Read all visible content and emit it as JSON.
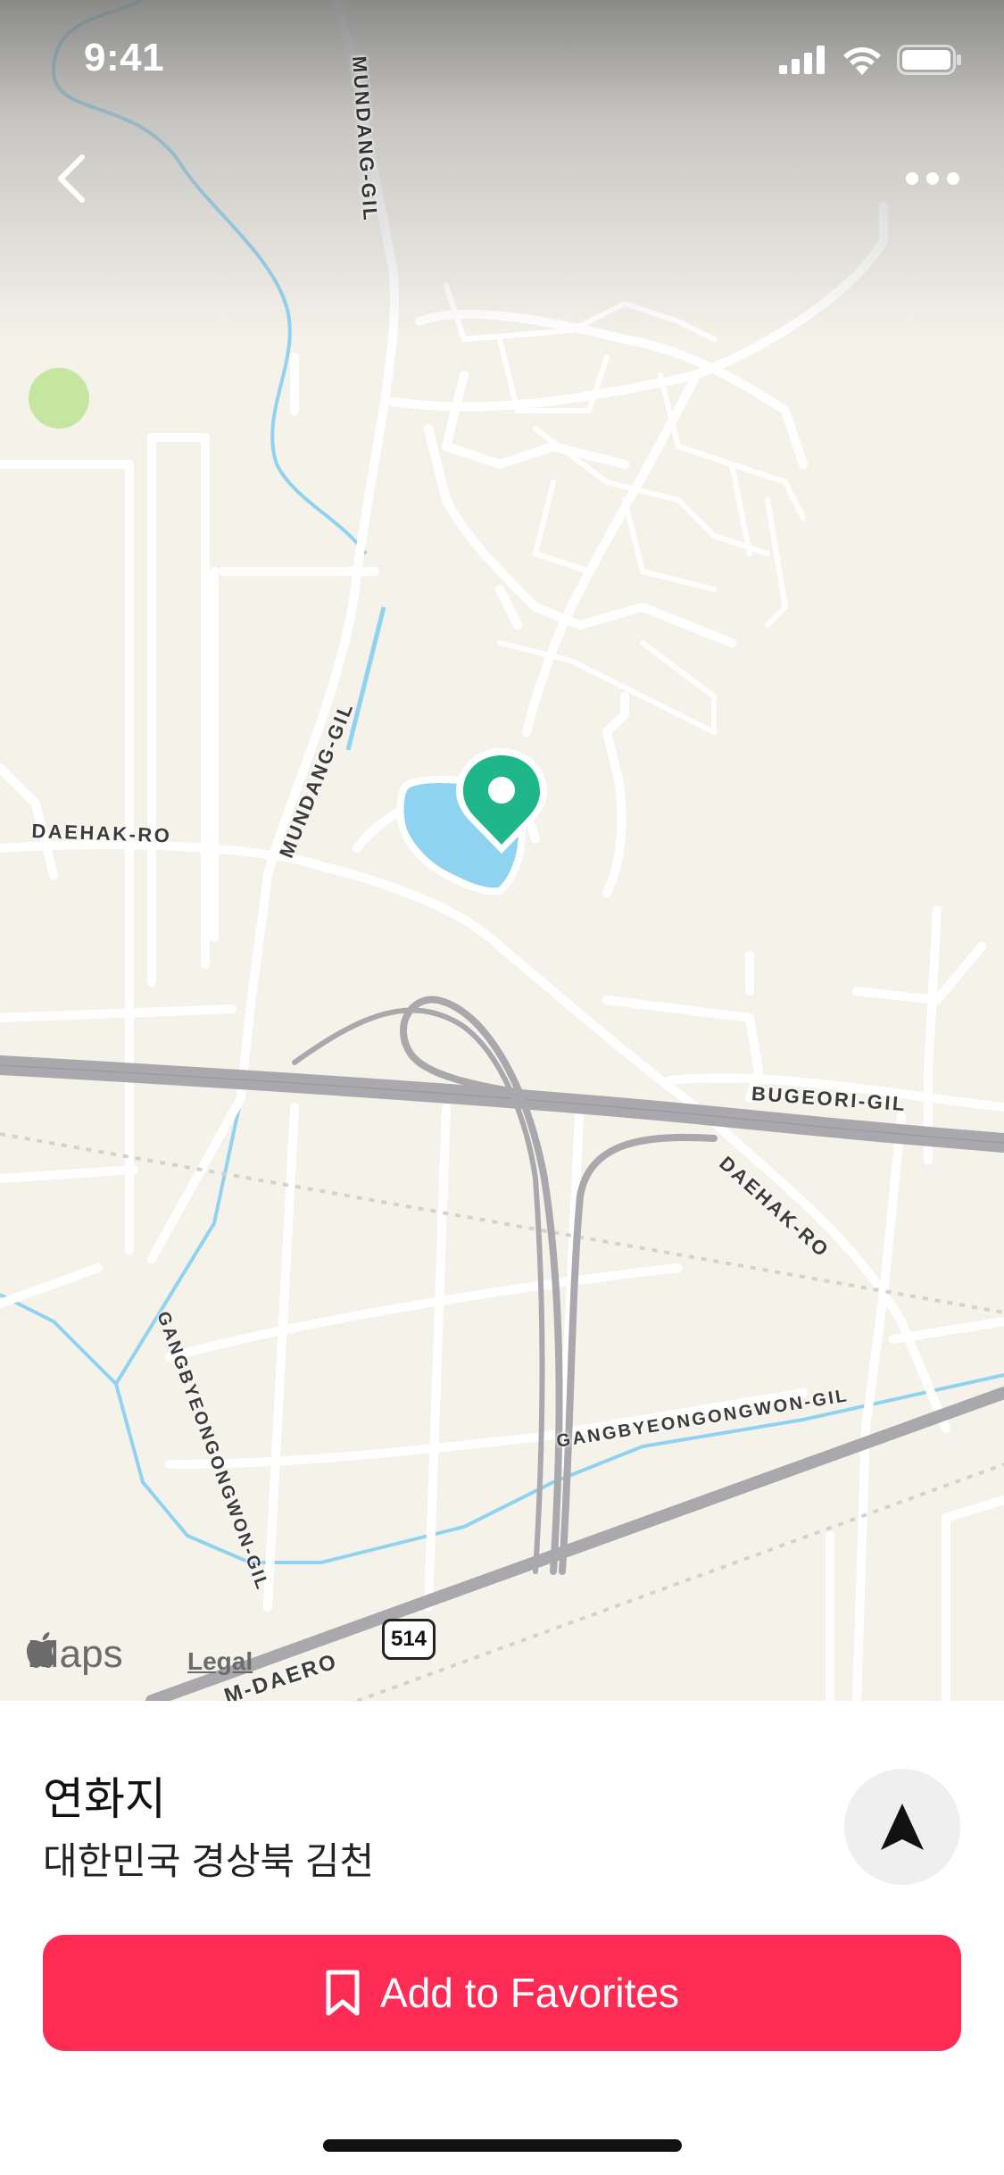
{
  "status_bar": {
    "time": "9:41"
  },
  "map": {
    "street_labels": {
      "mundang_gil_top": "MUNDANG-GIL",
      "mundang_gil_mid": "MUNDANG-GIL",
      "daehak_ro_left": "DAEHAK-RO",
      "daehak_ro_right": "DAEHAK-RO",
      "bugeori_gil": "BUGEORI-GIL",
      "gangbyeon_left": "GANGBYEONGONGWON-GIL",
      "gangbyeon_right": "GANGBYEONGONGWON-GIL",
      "daero_bottom": "M-DAERO"
    },
    "route_shield": "514",
    "attribution": {
      "brand": "Maps",
      "legal": "Legal"
    },
    "colors": {
      "land": "#f5f2ea",
      "road": "#ffffff",
      "highway": "#a9a9ad",
      "water": "#8fd3f0",
      "park": "#c4e6a0",
      "pin": "#1fb68a"
    }
  },
  "place": {
    "name": "연화지",
    "address": "대한민국 경상북 김천"
  },
  "actions": {
    "favorite_label": "Add to Favorites",
    "accent": "#fe2c55"
  },
  "icons": [
    "back-chevron-icon",
    "more-dots-icon",
    "location-pin-icon",
    "navigation-arrow-icon",
    "bookmark-icon",
    "apple-logo-icon",
    "signal-icon",
    "wifi-icon",
    "battery-icon"
  ]
}
